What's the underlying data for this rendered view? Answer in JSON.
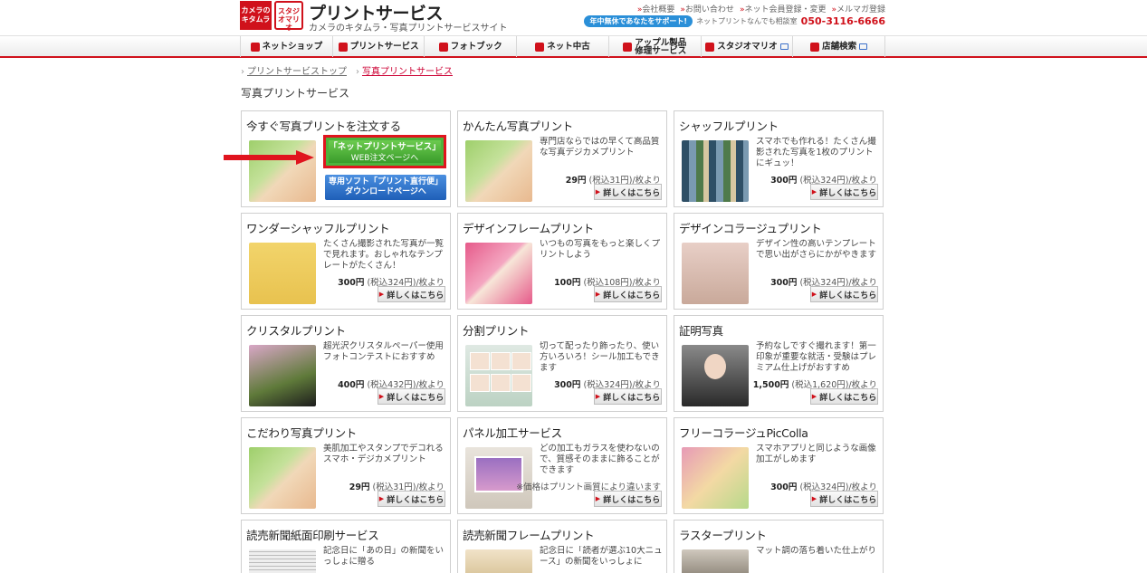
{
  "header": {
    "logo_kitamura": "カメラのキタムラ",
    "logo_studio": "スタジオマリオ",
    "title": "プリントサービス",
    "subtitle": "カメラのキタムラ・写真プリントサービスサイト",
    "top_links": [
      "会社概要",
      "お問い合わせ",
      "ネット会員登録・変更",
      "メルマガ登録"
    ],
    "support_badge": "年中無休であなたをサポート!",
    "support_text": "ネットプリントなんでも相談室",
    "support_phone": "050-3116-6666"
  },
  "nav": [
    {
      "label": "ネットショップ",
      "icon": "camera-icon"
    },
    {
      "label": "プリントサービス",
      "icon": "print-icon"
    },
    {
      "label": "フォトブック",
      "icon": "photobook-icon"
    },
    {
      "label": "ネット中古",
      "icon": "camera-icon"
    },
    {
      "label": "アップル製品\n修理サービス",
      "icon": "tools-icon"
    },
    {
      "label": "スタジオマリオ",
      "icon": "studio-icon"
    },
    {
      "label": "店舗検索",
      "icon": "house-icon"
    }
  ],
  "breadcrumb": [
    "プリントサービストップ",
    "写真プリントサービス"
  ],
  "page_title": "写真プリントサービス",
  "detail_label": "詳しくはこちら",
  "cards": [
    {
      "title": "今すぐ写真プリントを注文する",
      "order_green_1": "「ネットプリントサービス」",
      "order_green_2": "WEB注文ページへ",
      "order_blue_1": "専用ソフト「プリント直行便」",
      "order_blue_2": "ダウンロードページへ"
    },
    {
      "title": "かんたん写真プリント",
      "desc": "専門店ならではの早くて高品質な写真デジカメプリント",
      "price": "29円",
      "tax": "(税込31円)/枚より"
    },
    {
      "title": "シャッフルプリント",
      "desc": "スマホでも作れる！たくさん撮影された写真を1枚のプリントにギュッ！",
      "price": "300円",
      "tax": "(税込324円)/枚より"
    },
    {
      "title": "ワンダーシャッフルプリント",
      "desc": "たくさん撮影された写真が一覧で見れます。おしゃれなテンプレートがたくさん！",
      "price": "300円",
      "tax": "(税込324円)/枚より"
    },
    {
      "title": "デザインフレームプリント",
      "desc": "いつもの写真をもっと楽しくプリントしよう",
      "price": "100円",
      "tax": "(税込108円)/枚より"
    },
    {
      "title": "デザインコラージュプリント",
      "desc": "デザイン性の高いテンプレートで思い出がさらにかがやきます",
      "price": "300円",
      "tax": "(税込324円)/枚より"
    },
    {
      "title": "クリスタルプリント",
      "desc": "超光沢クリスタルペーパー使用 フォトコンテストにおすすめ",
      "price": "400円",
      "tax": "(税込432円)/枚より"
    },
    {
      "title": "分割プリント",
      "desc": "切って配ったり飾ったり、使い方いろいろ！シール加工もできます",
      "price": "300円",
      "tax": "(税込324円)/枚より"
    },
    {
      "title": "証明写真",
      "desc": "予約なしですぐ撮れます！第一印象が重要な就活・受験はプレミアム仕上げがおすすめ",
      "price": "1,500円",
      "tax": "(税込1,620円)/枚より"
    },
    {
      "title": "こだわり写真プリント",
      "desc": "美肌加工やスタンプでデコれるスマホ・デジカメプリント",
      "price": "29円",
      "tax": "(税込31円)/枚より"
    },
    {
      "title": "パネル加工サービス",
      "desc": "どの加工もガラスを使わないので、質感そのままに飾ることができます",
      "price": "",
      "tax": "※価格はプリント画質により違います"
    },
    {
      "title": "フリーコラージュPicColla",
      "desc": "スマホアプリと同じような画像加工がしめます",
      "price": "300円",
      "tax": "(税込324円)/枚より"
    },
    {
      "title": "読売新聞紙面印刷サービス",
      "desc": "記念日に「あの日」の新聞をいっしょに贈る"
    },
    {
      "title": "読売新聞フレームプリント",
      "desc": "記念日に「読者が選ぶ10大ニュース」の新聞をいっしょに"
    },
    {
      "title": "ラスタープリント",
      "desc": "マット調の落ち着いた仕上がり"
    }
  ]
}
